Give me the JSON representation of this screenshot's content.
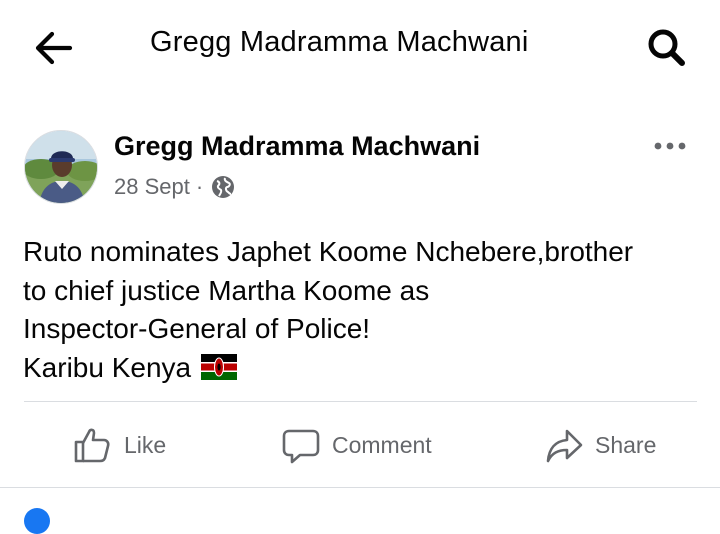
{
  "header": {
    "title": "Gregg Madramma Machwani"
  },
  "post": {
    "author": "Gregg Madramma Machwani",
    "date": "28 Sept",
    "separator": "·",
    "privacy_icon": "globe-icon",
    "text": "Ruto nominates Japhet Koome Nchebere,brother\nto chief justice Martha Koome as\nInspector-General of Police!\nKaribu Kenya",
    "flag": "kenya-flag"
  },
  "actions": {
    "like": "Like",
    "comment": "Comment",
    "share": "Share"
  },
  "colors": {
    "text": "#050505",
    "secondary": "#65676b",
    "divider": "#dadde1",
    "accent": "#1877f2"
  }
}
